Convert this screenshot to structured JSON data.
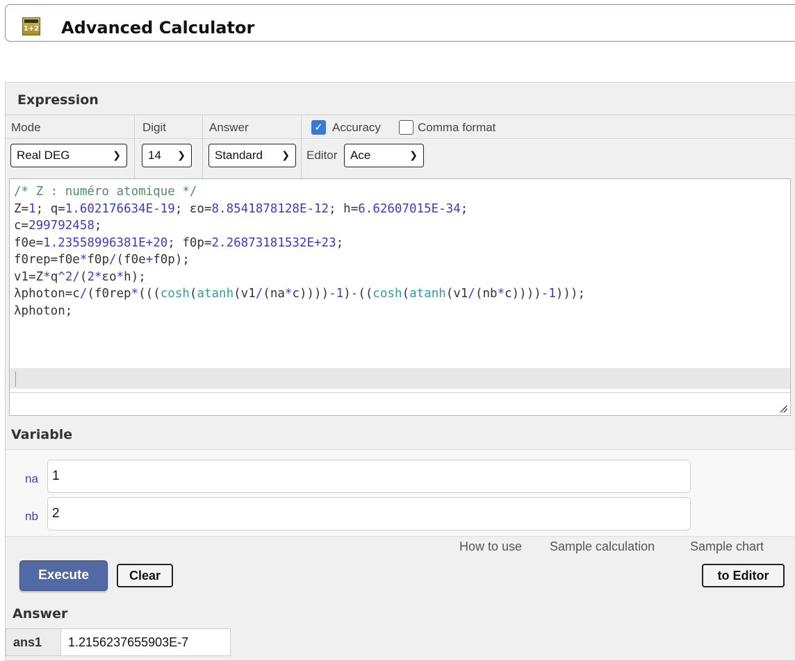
{
  "app": {
    "title": "Advanced Calculator",
    "icon_text": "1+2"
  },
  "expression": {
    "section_title": "Expression",
    "columns": {
      "mode_label": "Mode",
      "digit_label": "Digit",
      "answer_label": "Answer"
    },
    "mode_value": "Real DEG",
    "digit_value": "14",
    "answer_value": "Standard",
    "editor_label": "Editor",
    "editor_value": "Ace",
    "accuracy": {
      "label": "Accuracy",
      "checked": true
    },
    "comma_format": {
      "label": "Comma format",
      "checked": false
    },
    "code_lines": [
      "/* Z : numéro atomique */",
      "Z=1; q=1.602176634E-19; εo=8.8541878128E-12; h=6.62607015E-34;",
      "c=299792458;",
      "f0e=1.23558996381E+20; f0p=2.26873181532E+23;",
      "f0rep=f0e*f0p/(f0e+f0p);",
      "v1=Z*q^2/(2*εo*h);",
      "λphoton=c/(f0rep*(((cosh(atanh(v1/(na*c))))-1)-((cosh(atanh(v1/(nb*c))))-1)));",
      "λphoton;"
    ]
  },
  "variable": {
    "section_title": "Variable",
    "items": [
      {
        "name": "na",
        "value": "1"
      },
      {
        "name": "nb",
        "value": "2"
      }
    ]
  },
  "links": {
    "how_to_use": "How to use",
    "sample_calculation": "Sample calculation",
    "sample_chart": "Sample chart"
  },
  "buttons": {
    "execute": "Execute",
    "clear": "Clear",
    "to_editor": "to Editor"
  },
  "answer": {
    "section_title": "Answer",
    "rows": [
      {
        "name": "ans1",
        "value": "1.2156237655903E-7"
      }
    ]
  },
  "colors": {
    "execute_button": "#5369a4",
    "checkbox_checked": "#3a78d8",
    "code_number": "#3a3ad1",
    "code_comment": "#4d8d6b",
    "code_function": "#2f9f9f"
  }
}
